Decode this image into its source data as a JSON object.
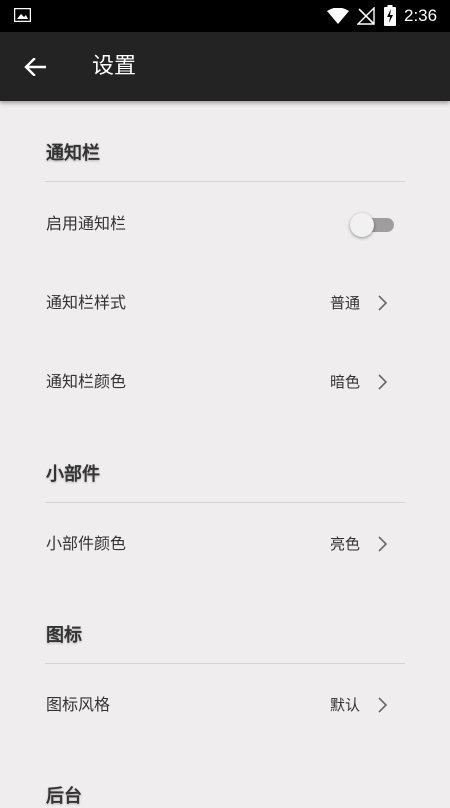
{
  "status_bar": {
    "time": "2:36",
    "icons": [
      "gallery-icon",
      "wifi-icon",
      "signal-off-icon",
      "battery-charging-icon"
    ]
  },
  "app_bar": {
    "back_icon": "arrow-left-icon",
    "title": "设置"
  },
  "sections": [
    {
      "header": "通知栏",
      "rows": [
        {
          "label": "启用通知栏",
          "control": "toggle",
          "enabled": false
        },
        {
          "label": "通知栏样式",
          "value": "普通"
        },
        {
          "label": "通知栏颜色",
          "value": "暗色"
        }
      ]
    },
    {
      "header": "小部件",
      "rows": [
        {
          "label": "小部件颜色",
          "value": "亮色"
        }
      ]
    },
    {
      "header": "图标",
      "rows": [
        {
          "label": "图标风格",
          "value": "默认"
        }
      ]
    },
    {
      "header": "后台",
      "rows": []
    }
  ],
  "colors": {
    "status_bar": "#000000",
    "app_bar": "#232323",
    "background": "#efedee",
    "divider": "#d5d3d4",
    "toggle_track": "#9e9e9e"
  }
}
